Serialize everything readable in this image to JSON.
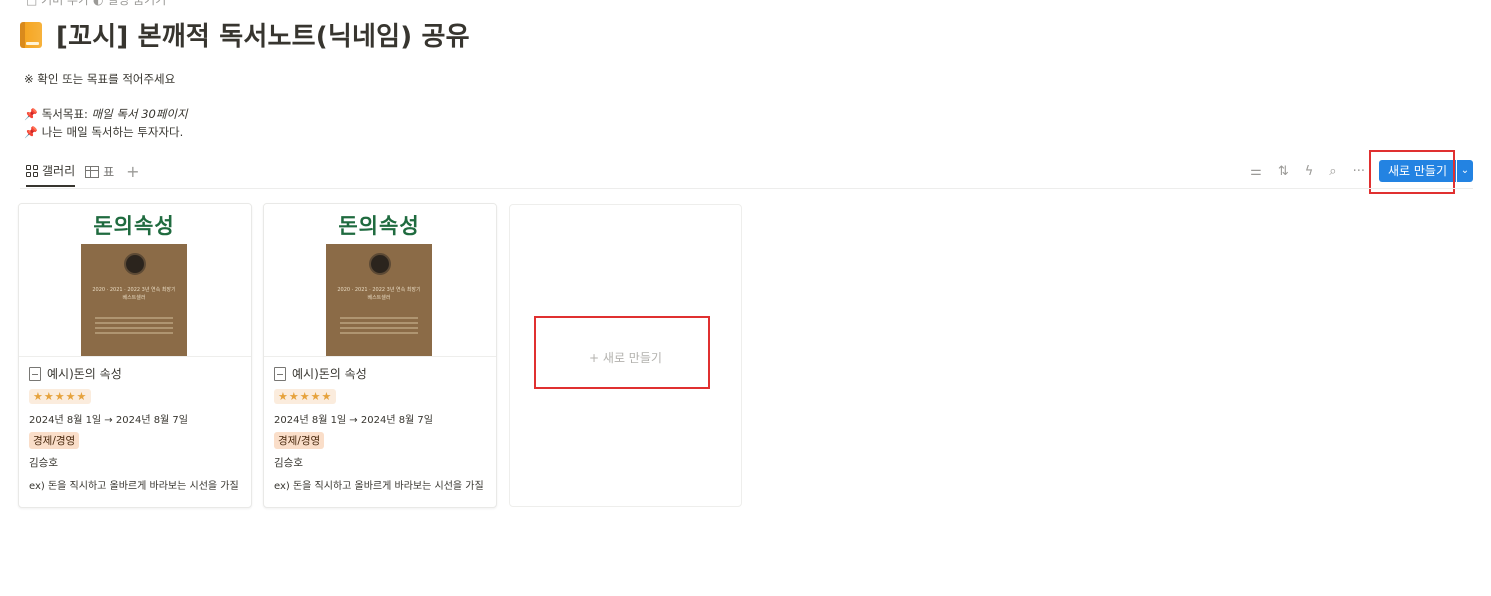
{
  "top_crumbs": "□ 커버 추가  ◐ 설명 숨기기",
  "page": {
    "title": "[꼬시] 본깨적 독서노트(닉네임) 공유",
    "icon": "orange-book-icon"
  },
  "description": {
    "line1": "※ 확인 또는 목표를 적어주세요",
    "goal_prefix": "독서목표: ",
    "goal_value": "매일 독서 30페이지",
    "line3": "나는 매일 독서하는 투자자다."
  },
  "views": {
    "gallery": "갤러리",
    "table": "표",
    "add": "+"
  },
  "toolbar": {
    "filter": "⚌",
    "sort": "⇅",
    "automation": "ϟ",
    "search": "⌕",
    "more": "···",
    "new_button": "새로 만들기",
    "caret": "⌄"
  },
  "book_cover": {
    "title": "돈의속성",
    "text": "2020 · 2021 · 2022 3년 연속 최장기 베스트셀러"
  },
  "cards": [
    {
      "name": "예시)돈의 속성",
      "rating": "★★★★★",
      "date": "2024년 8월 1일 → 2024년 8월 7일",
      "category": "경제/경영",
      "author": "김승호",
      "note": "ex) 돈을 직시하고 올바르게 바라보는 시선을 가질"
    },
    {
      "name": "예시)돈의 속성",
      "rating": "★★★★★",
      "date": "2024년 8월 1일 → 2024년 8월 7일",
      "category": "경제/경영",
      "author": "김승호",
      "note": "ex) 돈을 직시하고 올바르게 바라보는 시선을 가질"
    }
  ],
  "new_card": {
    "label": "+  새로 만들기"
  },
  "colors": {
    "accent": "#2383e2",
    "highlight": "#e03030",
    "tag_bg": "#fadec9",
    "stars_bg": "#fbecdd"
  }
}
